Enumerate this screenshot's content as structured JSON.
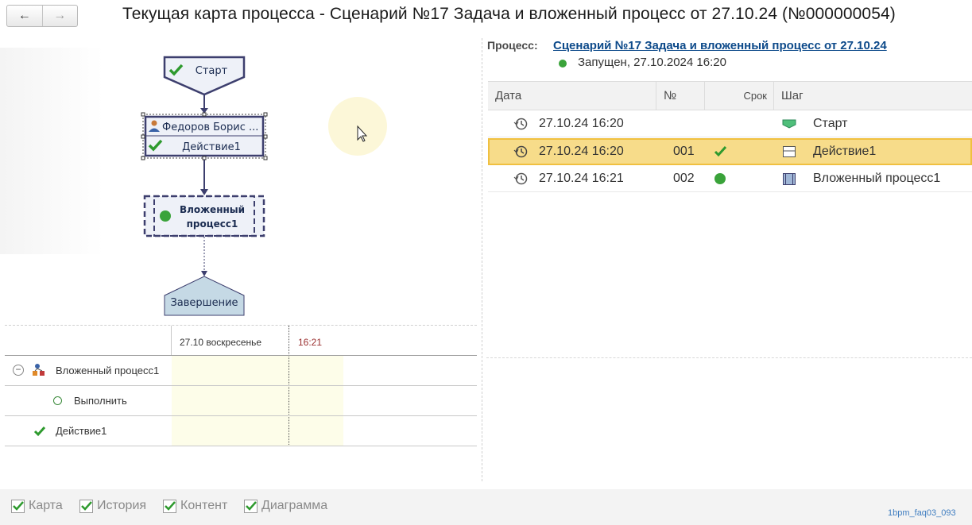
{
  "header": {
    "back_label": "←",
    "forward_label": "→",
    "title": "Текущая карта процесса - Сценарий №17 Задача и вложенный процесс от 27.10.24 (№000000054)"
  },
  "map": {
    "start_label": "Старт",
    "task_user": "Федоров Борис ...",
    "task_action": "Действие1",
    "subprocess_label_1": "Вложенный",
    "subprocess_label_2": "процесс1",
    "end_label": "Завершение"
  },
  "gantt": {
    "date_header": "27.10 воскресенье",
    "time_header": "16:21",
    "rows": [
      {
        "label": "Вложенный процесс1",
        "icon": "subprocess-icon",
        "expander": "⊖"
      },
      {
        "label": "Выполнить",
        "icon": "circle-icon"
      },
      {
        "label": "Действие1",
        "icon": "check-icon"
      }
    ]
  },
  "process": {
    "label": "Процесс:",
    "link": "Сценарий №17 Задача и вложенный процесс от 27.10.24",
    "status": "Запущен, 27.10.2024 16:20",
    "status_color": "#3aa33a"
  },
  "table": {
    "columns": [
      "Дата",
      "№",
      "Срок",
      "Шаг"
    ],
    "rows": [
      {
        "date": "27.10.24 16:20",
        "num": "",
        "term": "",
        "step": "Старт",
        "step_icon": "start-shape-icon"
      },
      {
        "date": "27.10.24 16:20",
        "num": "001",
        "term": "check",
        "step": "Действие1",
        "step_icon": "task-shape-icon",
        "selected": true
      },
      {
        "date": "27.10.24 16:21",
        "num": "002",
        "term": "dot",
        "step": "Вложенный процесс1",
        "step_icon": "subprocess-shape-icon"
      }
    ]
  },
  "footer": {
    "checkboxes": [
      {
        "label": "Карта",
        "checked": true
      },
      {
        "label": "История",
        "checked": true
      },
      {
        "label": "Контент",
        "checked": true
      },
      {
        "label": "Диаграмма",
        "checked": true
      }
    ],
    "watermark": "1bpm_faq03_093"
  },
  "colors": {
    "accent_link": "#0d4a8a",
    "selection": "#f7dc8a",
    "check_green": "#2e9a2e",
    "node_stroke": "#3d3f6e"
  }
}
